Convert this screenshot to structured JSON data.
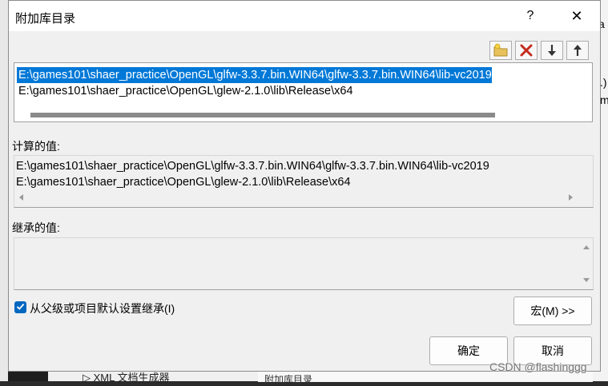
{
  "dialog": {
    "title": "附加库目录",
    "help_label": "?",
    "close_label": "✕"
  },
  "toolbar": {
    "icons": [
      "new-folder-icon",
      "delete-icon",
      "move-down-icon",
      "move-up-icon"
    ]
  },
  "list": {
    "items": [
      "E:\\games101\\shaer_practice\\OpenGL\\glfw-3.3.7.bin.WIN64\\glfw-3.3.7.bin.WIN64\\lib-vc2019",
      "E:\\games101\\shaer_practice\\OpenGL\\glew-2.1.0\\lib\\Release\\x64"
    ],
    "selected_index": 0
  },
  "computed": {
    "label": "计算的值:",
    "items": [
      "E:\\games101\\shaer_practice\\OpenGL\\glfw-3.3.7.bin.WIN64\\glfw-3.3.7.bin.WIN64\\lib-vc2019",
      "E:\\games101\\shaer_practice\\OpenGL\\glew-2.1.0\\lib\\Release\\x64"
    ]
  },
  "inherited": {
    "label": "继承的值:"
  },
  "inherit_checkbox": {
    "label": "从父级或项目默认设置继承(I)",
    "checked": true
  },
  "buttons": {
    "macros": "宏(M) >>",
    "ok": "确定",
    "cancel": "取消"
  },
  "background": {
    "right_edge_text_1": "a",
    "right_edge_text_2": ".)",
    "right_edge_text_3": "m",
    "bottom_left_item": "▷ XML 文档生成器",
    "bottom_right_text": "附加库目录"
  },
  "watermark": "CSDN @flashinggg",
  "colors": {
    "selection": "#0078d7",
    "checkbox": "#0067c0",
    "dialog_bg": "#f0f0f0"
  }
}
